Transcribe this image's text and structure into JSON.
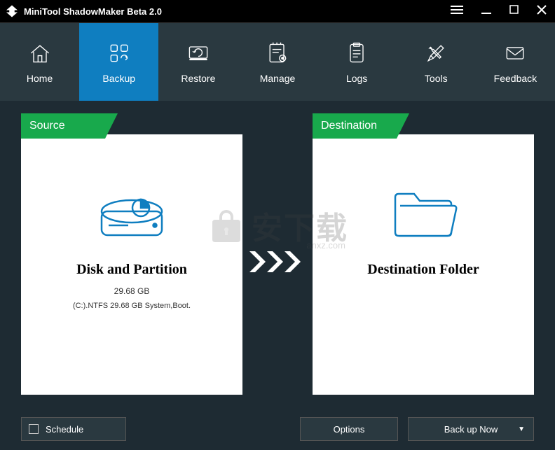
{
  "titlebar": {
    "title": "MiniTool ShadowMaker Beta 2.0"
  },
  "nav": {
    "items": [
      {
        "label": "Home"
      },
      {
        "label": "Backup"
      },
      {
        "label": "Restore"
      },
      {
        "label": "Manage"
      },
      {
        "label": "Logs"
      },
      {
        "label": "Tools"
      },
      {
        "label": "Feedback"
      }
    ]
  },
  "source": {
    "header": "Source",
    "title": "Disk and Partition",
    "size": "29.68 GB",
    "detail": "(C:).NTFS 29.68 GB System,Boot."
  },
  "destination": {
    "header": "Destination",
    "title": "Destination Folder"
  },
  "buttons": {
    "schedule": "Schedule",
    "options": "Options",
    "backup_now": "Back up Now"
  },
  "watermark": {
    "text": "安下载",
    "sub": "anxz.com"
  }
}
